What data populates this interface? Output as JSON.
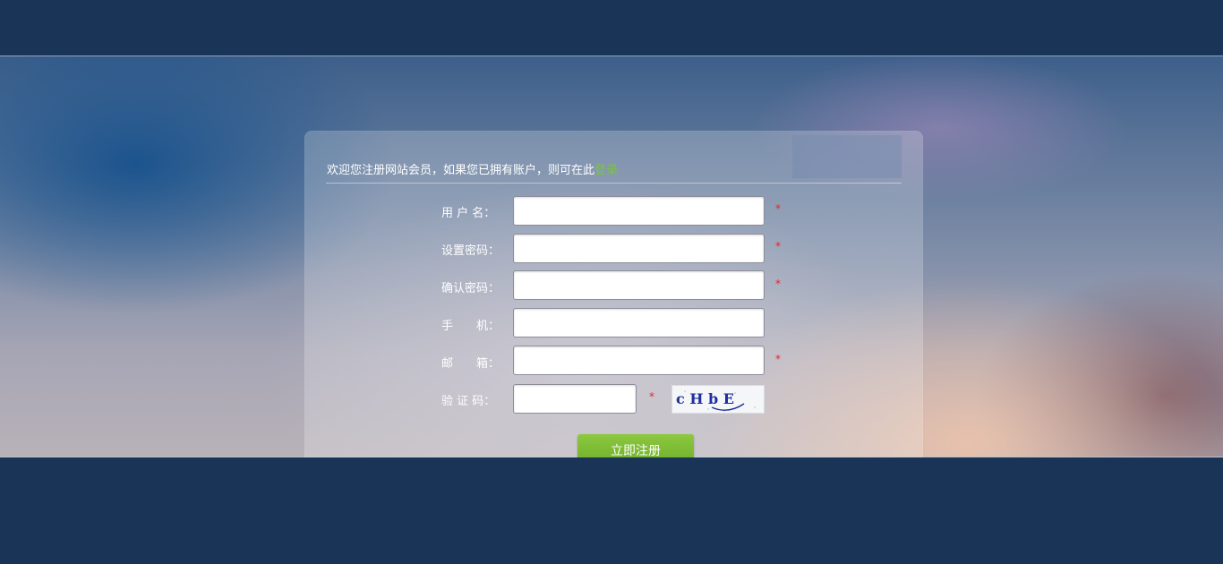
{
  "form": {
    "welcome_text": "欢迎您注册网站会员，如果您已拥有账户，则可在此",
    "login_link": "登录",
    "fields": [
      {
        "label": "用 户 名：",
        "value": "",
        "required": true
      },
      {
        "label": "设置密码：",
        "value": "",
        "required": true
      },
      {
        "label": "确认密码：",
        "value": "",
        "required": true
      },
      {
        "label": "手　　机：",
        "value": "",
        "required": false
      },
      {
        "label": "邮　　箱：",
        "value": "",
        "required": true
      },
      {
        "label": "验 证 码：",
        "value": "",
        "required": true
      }
    ],
    "required_mark": "*",
    "captcha_text": "c H b E",
    "submit_label": "立即注册"
  },
  "colors": {
    "header_bg": "#1a3457",
    "accent_green": "#7dc242",
    "required_red": "#e8232d"
  }
}
